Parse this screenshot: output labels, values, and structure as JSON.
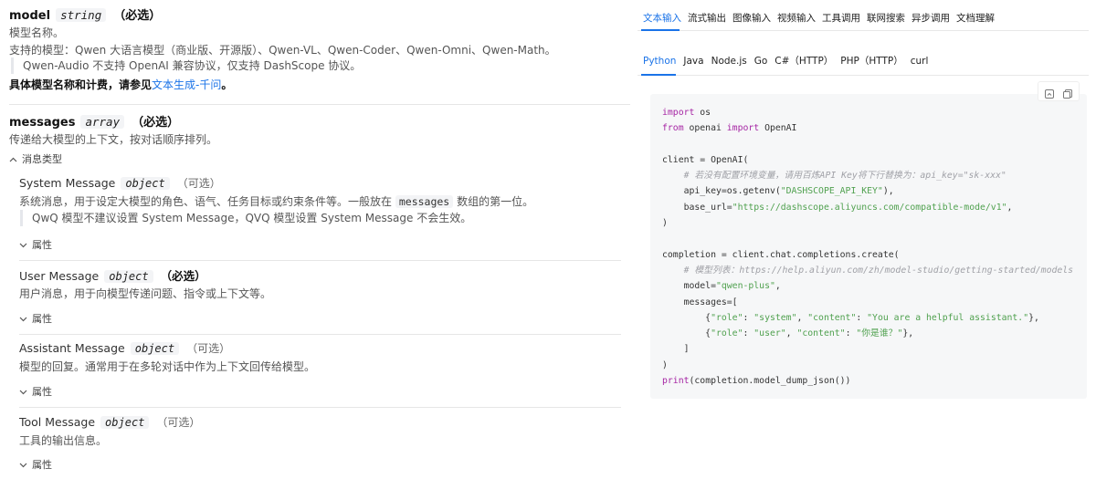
{
  "model": {
    "name": "model",
    "type": "string",
    "requirement": "（必选）",
    "desc": "模型名称。",
    "supported": "支持的模型：Qwen 大语言模型（商业版、开源版）、Qwen-VL、Qwen-Coder、Qwen-Omni、Qwen-Math。",
    "note": "Qwen-Audio 不支持 OpenAI 兼容协议，仅支持 DashScope 协议。",
    "pricing_prefix": "具体模型名称和计费，请参见",
    "pricing_link": "文本生成-千问",
    "pricing_suffix": "。"
  },
  "messages": {
    "name": "messages",
    "type": "array",
    "requirement": "（必选）",
    "desc": "传递给大模型的上下文，按对话顺序排列。",
    "toggle_label": "消息类型",
    "items": [
      {
        "name": "System Message",
        "type": "object",
        "requirement": "（可选）",
        "desc_prefix": "系统消息，用于设定大模型的角色、语气、任务目标或约束条件等。一般放在",
        "desc_code": "messages",
        "desc_suffix": "数组的第一位。",
        "note": "QwQ 模型不建议设置 System Message，QVQ 模型设置 System Message 不会生效。",
        "attr_label": "属性"
      },
      {
        "name": "User Message",
        "type": "object",
        "requirement": "（必选）",
        "desc_prefix": "用户消息，用于向模型传递问题、指令或上下文等。",
        "attr_label": "属性"
      },
      {
        "name": "Assistant Message",
        "type": "object",
        "requirement": "（可选）",
        "desc_prefix": "模型的回复。通常用于在多轮对话中作为上下文回传给模型。",
        "attr_label": "属性"
      },
      {
        "name": "Tool Message",
        "type": "object",
        "requirement": "（可选）",
        "desc_prefix": "工具的输出信息。",
        "attr_label": "属性"
      }
    ]
  },
  "right": {
    "main_tabs": [
      "文本输入",
      "流式输出",
      "图像输入",
      "视频输入",
      "工具调用",
      "联网搜索",
      "异步调用",
      "文档理解"
    ],
    "lang_tabs": [
      "Python",
      "Java",
      "Node.js",
      "Go",
      "C#（HTTP）",
      "PHP（HTTP）",
      "curl"
    ],
    "code_lines": [
      [
        {
          "t": "import",
          "c": "kw"
        },
        {
          "t": " os"
        }
      ],
      [
        {
          "t": "from",
          "c": "kw"
        },
        {
          "t": " openai "
        },
        {
          "t": "import",
          "c": "kw"
        },
        {
          "t": " OpenAI"
        }
      ],
      [],
      [
        {
          "t": "client = OpenAI("
        }
      ],
      [
        {
          "t": "    "
        },
        {
          "t": "# 若没有配置环境变量，请用百炼API Key将下行替换为：api_key=\"sk-xxx\"",
          "c": "cm"
        }
      ],
      [
        {
          "t": "    api_key=os.getenv("
        },
        {
          "t": "\"DASHSCOPE_API_KEY\"",
          "c": "str"
        },
        {
          "t": "),"
        }
      ],
      [
        {
          "t": "    base_url="
        },
        {
          "t": "\"https://dashscope.aliyuncs.com/compatible-mode/v1\"",
          "c": "str"
        },
        {
          "t": ","
        }
      ],
      [
        {
          "t": ")"
        }
      ],
      [],
      [
        {
          "t": "completion = client.chat.completions.create("
        }
      ],
      [
        {
          "t": "    "
        },
        {
          "t": "# 模型列表：https://help.aliyun.com/zh/model-studio/getting-started/models",
          "c": "cm"
        }
      ],
      [
        {
          "t": "    model="
        },
        {
          "t": "\"qwen-plus\"",
          "c": "str"
        },
        {
          "t": ","
        }
      ],
      [
        {
          "t": "    messages=["
        }
      ],
      [
        {
          "t": "        {"
        },
        {
          "t": "\"role\"",
          "c": "str"
        },
        {
          "t": ": "
        },
        {
          "t": "\"system\"",
          "c": "str"
        },
        {
          "t": ", "
        },
        {
          "t": "\"content\"",
          "c": "str"
        },
        {
          "t": ": "
        },
        {
          "t": "\"You are a helpful assistant.\"",
          "c": "str"
        },
        {
          "t": "},"
        }
      ],
      [
        {
          "t": "        {"
        },
        {
          "t": "\"role\"",
          "c": "str"
        },
        {
          "t": ": "
        },
        {
          "t": "\"user\"",
          "c": "str"
        },
        {
          "t": ", "
        },
        {
          "t": "\"content\"",
          "c": "str"
        },
        {
          "t": ": "
        },
        {
          "t": "\"你是谁？\"",
          "c": "str"
        },
        {
          "t": "},"
        }
      ],
      [
        {
          "t": "    ]"
        }
      ],
      [
        {
          "t": ")"
        }
      ],
      [
        {
          "t": "print",
          "c": "fn"
        },
        {
          "t": "(completion.model_dump_json())"
        }
      ]
    ]
  },
  "colors": {
    "accent": "#1a73e8",
    "kw": "#a626a4",
    "str": "#50a14f",
    "cm": "#a0a1a7",
    "fn": "#a626a4"
  }
}
